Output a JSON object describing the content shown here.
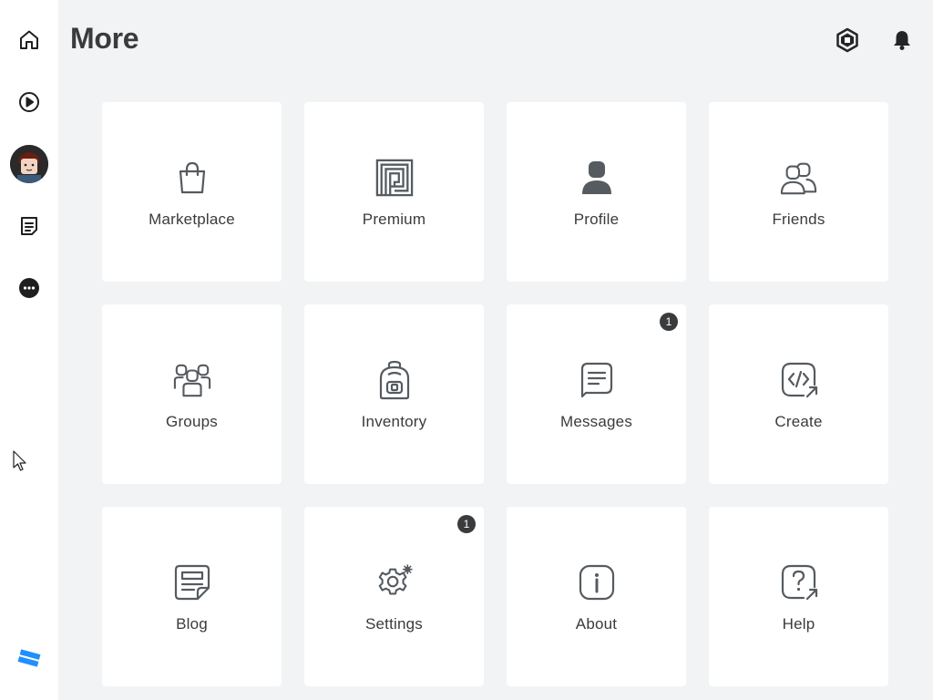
{
  "page": {
    "title": "More"
  },
  "sidebar": {
    "items": [
      {
        "name": "home",
        "icon": "home-icon"
      },
      {
        "name": "discover",
        "icon": "play-icon"
      },
      {
        "name": "avatar",
        "icon": "avatar-image"
      },
      {
        "name": "chat",
        "icon": "chat-icon"
      },
      {
        "name": "more",
        "icon": "more-icon"
      }
    ],
    "logo": "roblox-logo"
  },
  "header": {
    "icons": [
      "robux-icon",
      "notifications-bell-icon"
    ]
  },
  "tiles": [
    {
      "label": "Marketplace",
      "icon": "shopping-bag-icon",
      "badge": ""
    },
    {
      "label": "Premium",
      "icon": "premium-icon",
      "badge": ""
    },
    {
      "label": "Profile",
      "icon": "profile-icon",
      "badge": ""
    },
    {
      "label": "Friends",
      "icon": "friends-icon",
      "badge": ""
    },
    {
      "label": "Groups",
      "icon": "groups-icon",
      "badge": ""
    },
    {
      "label": "Inventory",
      "icon": "backpack-icon",
      "badge": ""
    },
    {
      "label": "Messages",
      "icon": "messages-icon",
      "badge": "1"
    },
    {
      "label": "Create",
      "icon": "create-code-icon",
      "badge": ""
    },
    {
      "label": "Blog",
      "icon": "blog-icon",
      "badge": ""
    },
    {
      "label": "Settings",
      "icon": "settings-gear-icon",
      "badge": "1"
    },
    {
      "label": "About",
      "icon": "info-icon",
      "badge": ""
    },
    {
      "label": "Help",
      "icon": "help-icon",
      "badge": ""
    }
  ],
  "colors": {
    "background": "#f2f3f5",
    "tile": "#ffffff",
    "text": "#393b3d",
    "icon": "#555b60",
    "badge": "#393b3d",
    "logo": "#1e90ff"
  }
}
